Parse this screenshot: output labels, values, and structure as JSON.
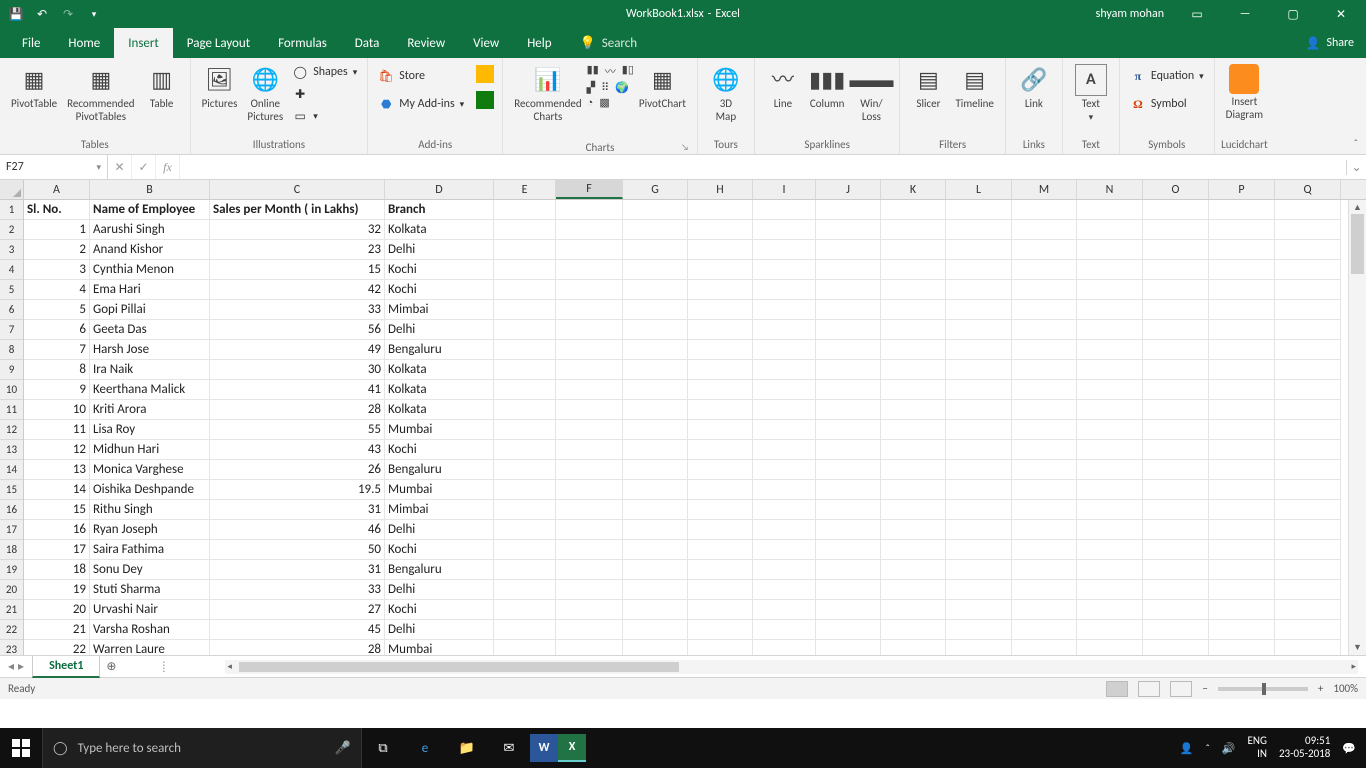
{
  "titlebar": {
    "filename": "WorkBook1.xlsx",
    "app": "Excel",
    "user": "shyam mohan"
  },
  "ribbon": {
    "tabs": [
      "File",
      "Home",
      "Insert",
      "Page Layout",
      "Formulas",
      "Data",
      "Review",
      "View",
      "Help"
    ],
    "active": "Insert",
    "search": "Search",
    "share": "Share",
    "groups": {
      "tables": {
        "label": "Tables",
        "pivot": "PivotTable",
        "recpivot": "Recommended\nPivotTables",
        "table": "Table"
      },
      "illus": {
        "label": "Illustrations",
        "pictures": "Pictures",
        "online": "Online\nPictures",
        "shapes": "Shapes"
      },
      "addins": {
        "label": "Add-ins",
        "store": "Store",
        "myaddins": "My Add-ins"
      },
      "charts": {
        "label": "Charts",
        "rec": "Recommended\nCharts",
        "pivotchart": "PivotChart"
      },
      "tours": {
        "label": "Tours",
        "map": "3D\nMap"
      },
      "spark": {
        "label": "Sparklines",
        "line": "Line",
        "column": "Column",
        "winloss": "Win/\nLoss"
      },
      "filters": {
        "label": "Filters",
        "slicer": "Slicer",
        "timeline": "Timeline"
      },
      "links": {
        "label": "Links",
        "link": "Link"
      },
      "text": {
        "label": "Text",
        "text": "Text"
      },
      "symbols": {
        "label": "Symbols",
        "equation": "Equation",
        "symbol": "Symbol"
      },
      "lucid": {
        "label": "Lucidchart",
        "insert": "Insert\nDiagram"
      }
    }
  },
  "formula_bar": {
    "namebox": "F27"
  },
  "sheet": {
    "columns": [
      "A",
      "B",
      "C",
      "D",
      "E",
      "F",
      "G",
      "H",
      "I",
      "J",
      "K",
      "L",
      "M",
      "N",
      "O",
      "P",
      "Q"
    ],
    "selected_col": "F",
    "headers": {
      "a": "Sl. No.",
      "b": "Name of Employee",
      "c": "Sales per Month ( in Lakhs)",
      "d": "Branch"
    },
    "rows": [
      {
        "n": 1,
        "sl": 1,
        "name": "Aarushi Singh",
        "sales": 32,
        "branch": "Kolkata"
      },
      {
        "n": 2,
        "sl": 2,
        "name": "Anand Kishor",
        "sales": 23,
        "branch": "Delhi"
      },
      {
        "n": 3,
        "sl": 3,
        "name": "Cynthia Menon",
        "sales": 15,
        "branch": "Kochi"
      },
      {
        "n": 4,
        "sl": 4,
        "name": "Ema Hari",
        "sales": 42,
        "branch": "Kochi"
      },
      {
        "n": 5,
        "sl": 5,
        "name": "Gopi Pillai",
        "sales": 33,
        "branch": "Mimbai"
      },
      {
        "n": 6,
        "sl": 6,
        "name": "Geeta Das",
        "sales": 56,
        "branch": "Delhi"
      },
      {
        "n": 7,
        "sl": 7,
        "name": "Harsh Jose",
        "sales": 49,
        "branch": "Bengaluru"
      },
      {
        "n": 8,
        "sl": 8,
        "name": "Ira Naik",
        "sales": 30,
        "branch": "Kolkata"
      },
      {
        "n": 9,
        "sl": 9,
        "name": "Keerthana Malick",
        "sales": 41,
        "branch": "Kolkata"
      },
      {
        "n": 10,
        "sl": 10,
        "name": "Kriti Arora",
        "sales": 28,
        "branch": "Kolkata"
      },
      {
        "n": 11,
        "sl": 11,
        "name": "Lisa Roy",
        "sales": 55,
        "branch": "Mumbai"
      },
      {
        "n": 12,
        "sl": 12,
        "name": "Midhun Hari",
        "sales": 43,
        "branch": "Kochi"
      },
      {
        "n": 13,
        "sl": 13,
        "name": "Monica Varghese",
        "sales": 26,
        "branch": "Bengaluru"
      },
      {
        "n": 14,
        "sl": 14,
        "name": "Oishika Deshpande",
        "sales": 19.5,
        "branch": "Mumbai"
      },
      {
        "n": 15,
        "sl": 15,
        "name": "Rithu Singh",
        "sales": 31,
        "branch": "Mimbai"
      },
      {
        "n": 16,
        "sl": 16,
        "name": "Ryan Joseph",
        "sales": 46,
        "branch": "Delhi"
      },
      {
        "n": 17,
        "sl": 17,
        "name": "Saira Fathima",
        "sales": 50,
        "branch": "Kochi"
      },
      {
        "n": 18,
        "sl": 18,
        "name": "Sonu Dey",
        "sales": 31,
        "branch": "Bengaluru"
      },
      {
        "n": 19,
        "sl": 19,
        "name": "Stuti Sharma",
        "sales": 33,
        "branch": "Delhi"
      },
      {
        "n": 20,
        "sl": 20,
        "name": "Urvashi Nair",
        "sales": 27,
        "branch": "Kochi"
      },
      {
        "n": 21,
        "sl": 21,
        "name": "Varsha Roshan",
        "sales": 45,
        "branch": "Delhi"
      },
      {
        "n": 22,
        "sl": 22,
        "name": "Warren Laure",
        "sales": 28,
        "branch": "Mumbai"
      }
    ]
  },
  "sheet_tabs": {
    "active": "Sheet1"
  },
  "status": {
    "ready": "Ready",
    "zoom": "100%"
  },
  "taskbar": {
    "search_placeholder": "Type here to search",
    "lang": "ENG",
    "locale": "IN",
    "time": "09:51",
    "date": "23-05-2018"
  }
}
